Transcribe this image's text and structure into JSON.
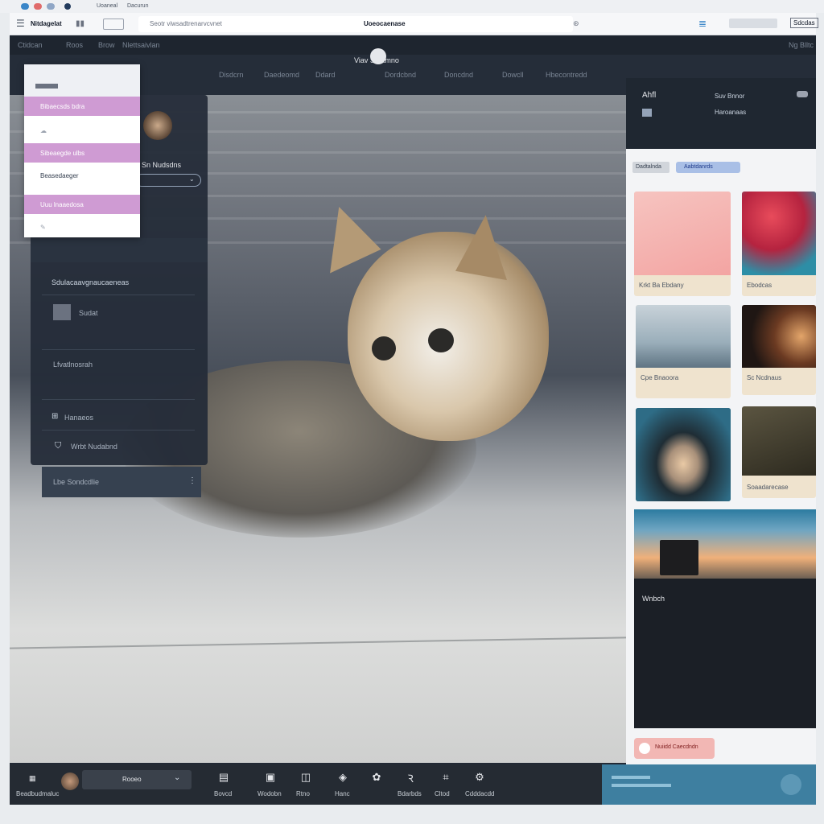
{
  "browser": {
    "tabs": [
      "Uoaneal",
      "Dacurun"
    ],
    "nav_label": "Nitdagelat",
    "url": "Seotr viwsadtrenarvcvnet",
    "page_title": "Uoeocaenase",
    "right_button": "Sdcdas"
  },
  "app": {
    "topnav": [
      "Ctidcan",
      "Roos",
      "Brow",
      "Nlettsaivlan"
    ],
    "topnav_right": "Ng Blltc",
    "brand": "Viav Snatmno",
    "secondary_nav": [
      "Disdcrn",
      "Daedeomd",
      "Ddard",
      "Dordcbnd",
      "Doncdnd",
      "Dowcll",
      "Hbecontredd"
    ]
  },
  "dropdown": {
    "items": [
      "",
      "Bibaecsds bdra",
      "",
      "Sibeaegde ulbs",
      "Beasedaeger",
      "Uuu lnaaedosa"
    ]
  },
  "leftpanel": {
    "username": "Sn Nudsdns",
    "section_title": "Sdulacaavgnaucaeneas",
    "rows": [
      "Sudat",
      "Lfvatlnosrah",
      "Hanaeos",
      "Wrbt Nudabnd",
      "Lbe Sondcdlie"
    ]
  },
  "rightpanel": {
    "header": [
      "Ahfl",
      "Suv Bnnor",
      "Haroanaas"
    ],
    "chips": [
      "Dadtalnda",
      "Aabtdanrds"
    ],
    "cards": [
      {
        "caption": "Krkt Ba Ebdany",
        "color": "#f3a9a8"
      },
      {
        "caption": "Ebodcas",
        "color": "#c2335a"
      },
      {
        "caption": "Cpe Bnaoora",
        "color": "#9cb1c0"
      },
      {
        "caption": "Sc Ncdnaus",
        "color": "#3a2a22"
      },
      {
        "caption": "",
        "color": "#2e6c86"
      },
      {
        "caption": "Soaadarecase",
        "color": "#3b3526"
      }
    ],
    "panel_title": "Wnbch",
    "pink_button": "Nuiidd Caecdndn"
  },
  "bottombar": {
    "user_label": "Beadbudmaluc",
    "search_value": "Rooeo",
    "items": [
      "Bovcd",
      "Wodobn",
      "Rtno",
      "Hanc",
      "Bdarbds",
      "Cltod",
      "Cdddacdd"
    ]
  },
  "colors": {
    "accent": "#cf9bd3",
    "teal": "#3e7fa0",
    "dark": "#232a35"
  }
}
